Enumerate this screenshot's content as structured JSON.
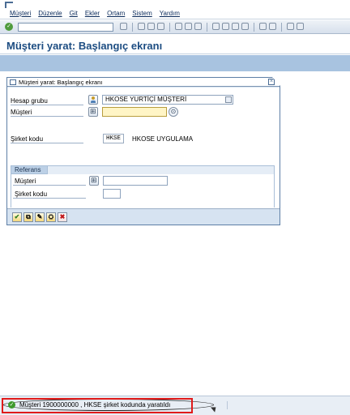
{
  "menu": {
    "items": [
      "Müşteri",
      "Düzenle",
      "Git",
      "Ekler",
      "Ortam",
      "Sistem",
      "Yardım"
    ]
  },
  "page": {
    "title": "Müşteri yarat: Başlangıç ekranı"
  },
  "dialog": {
    "title": "Müşteri yarat: Başlangıç ekranı",
    "fields": {
      "account_group_label": "Hesap grubu",
      "account_group_value": "HKOSE  YURTİÇİ MÜŞTERİ",
      "customer_label": "Müşteri",
      "customer_value": "",
      "company_code_label": "Şirket kodu",
      "company_code_value": "HKSE",
      "company_code_desc": "HKOSE UYGULAMA"
    },
    "reference": {
      "title": "Referans",
      "customer_label": "Müşteri",
      "customer_value": "",
      "company_code_label": "Şirket kodu",
      "company_code_value": ""
    }
  },
  "status": {
    "message": "Müşteri 1900000000 , HKSE şirket kodunda yaratıldı"
  },
  "colors": {
    "title": "#1d4d82",
    "highlight": "#e01b1b",
    "focus_field": "#fff5c6"
  }
}
